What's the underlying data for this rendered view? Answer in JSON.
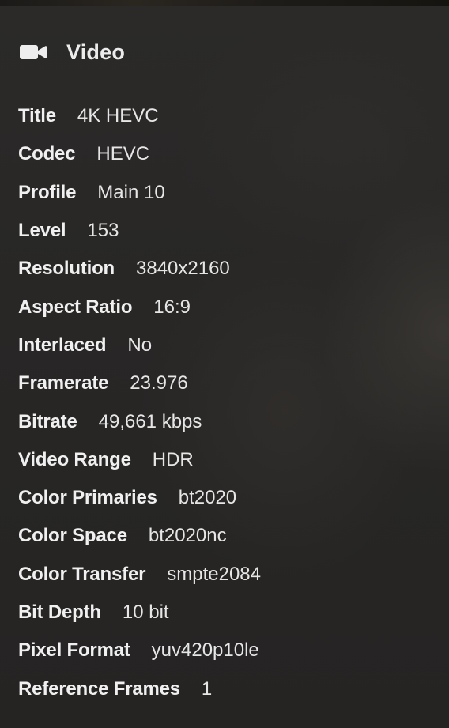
{
  "section": {
    "icon": "video-camera-icon",
    "title": "Video"
  },
  "colors": {
    "text_label": "#f0f0f0",
    "text_value": "#e6e6e6",
    "background": "#282726"
  },
  "rows": [
    {
      "label": "Title",
      "value": "4K HEVC"
    },
    {
      "label": "Codec",
      "value": "HEVC"
    },
    {
      "label": "Profile",
      "value": "Main 10"
    },
    {
      "label": "Level",
      "value": "153"
    },
    {
      "label": "Resolution",
      "value": "3840x2160"
    },
    {
      "label": "Aspect Ratio",
      "value": "16:9"
    },
    {
      "label": "Interlaced",
      "value": "No"
    },
    {
      "label": "Framerate",
      "value": "23.976"
    },
    {
      "label": "Bitrate",
      "value": "49,661 kbps"
    },
    {
      "label": "Video Range",
      "value": "HDR"
    },
    {
      "label": "Color Primaries",
      "value": "bt2020"
    },
    {
      "label": "Color Space",
      "value": "bt2020nc"
    },
    {
      "label": "Color Transfer",
      "value": "smpte2084"
    },
    {
      "label": "Bit Depth",
      "value": "10 bit"
    },
    {
      "label": "Pixel Format",
      "value": "yuv420p10le"
    },
    {
      "label": "Reference Frames",
      "value": "1"
    }
  ]
}
